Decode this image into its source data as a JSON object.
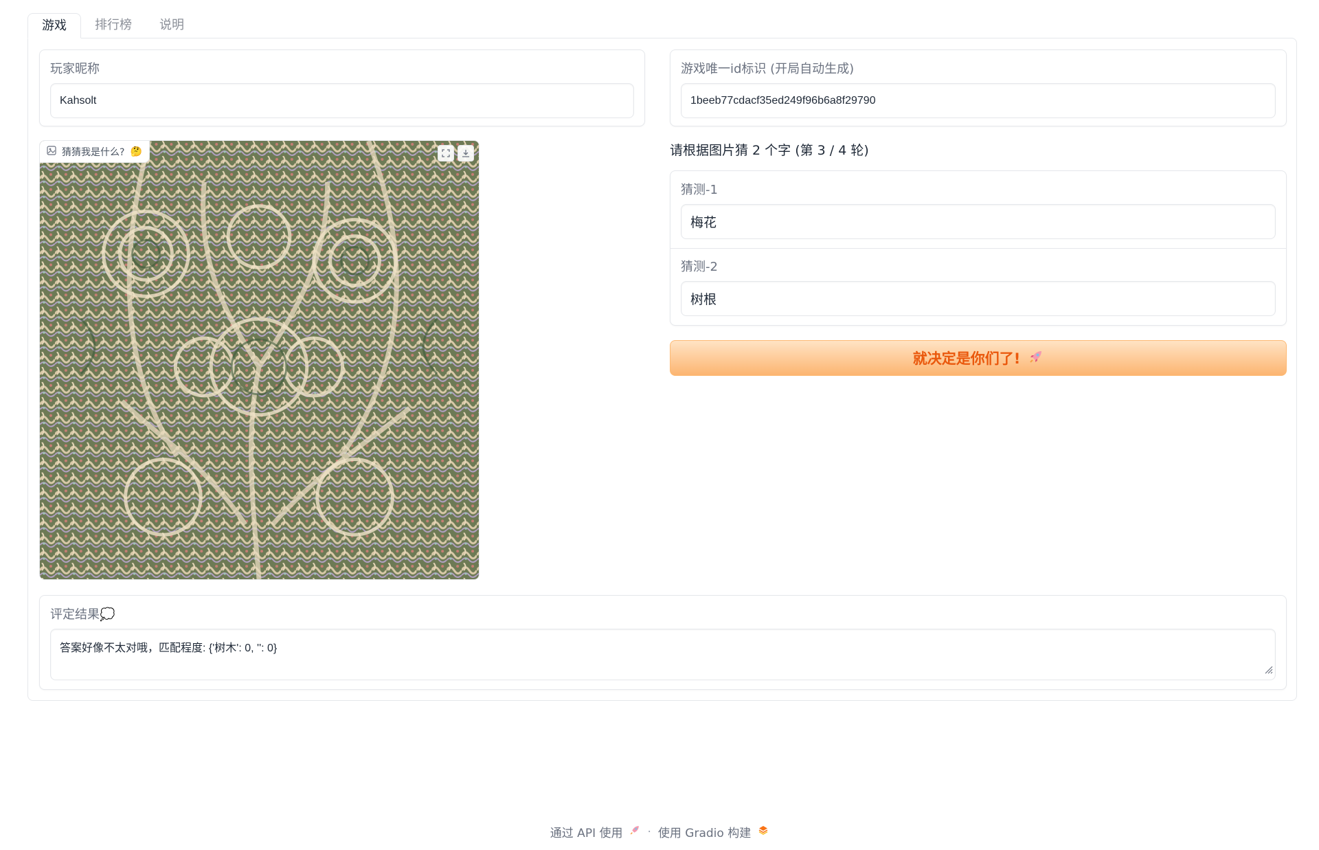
{
  "tabs": [
    "游戏",
    "排行榜",
    "说明"
  ],
  "player": {
    "label": "玩家昵称",
    "value": "Kahsolt"
  },
  "game_id": {
    "label": "游戏唯一id标识 (开局自动生成)",
    "value": "1beeb77cdacf35ed249f96b6a8f29790"
  },
  "image": {
    "label": "猜猜我是什么?",
    "label_emoji": "🤔"
  },
  "instruction": "请根据图片猜 2 个字 (第 3 / 4 轮)",
  "guesses": [
    {
      "label": "猜测-1",
      "value": "梅花"
    },
    {
      "label": "猜测-2",
      "value": "树根"
    }
  ],
  "submit": {
    "label": "就决定是你们了!",
    "icon": "rocket-icon"
  },
  "result": {
    "label": "评定结果💭",
    "value": "答案好像不太对哦，匹配程度: {'树木': 0, '': 0}"
  },
  "footer": {
    "api_label": "通过 API 使用",
    "built_label": "使用 Gradio 构建"
  }
}
